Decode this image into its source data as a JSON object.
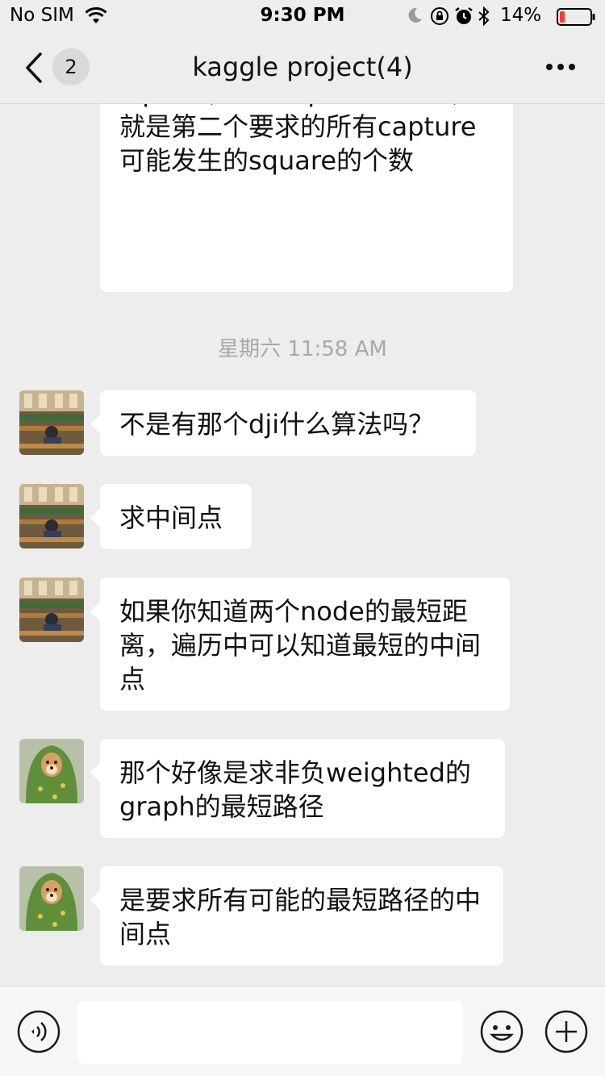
{
  "status_bar": {
    "carrier": "No SIM",
    "time": "9:30 PM",
    "battery": "14%",
    "battery_color": "#ff3b30",
    "icons": [
      "wifi-icon",
      "moon-icon",
      "orientation-lock-icon",
      "alarm-icon",
      "bluetooth-icon",
      "battery-icon"
    ]
  },
  "header": {
    "back_badge": "2",
    "title": "kaggle project(4)",
    "more_icon": "more-dots-icon"
  },
  "chat": {
    "timestamp": "星期六 11:58 AM",
    "messages": [
      {
        "sender": "dog-avatar",
        "text": "离，找到所有最短路径的中间的square，这些square的个数，就是第二个要求的所有capture可能发生的square的个数"
      },
      {
        "sender": "library-avatar",
        "text": "不是有那个dji什么算法吗？"
      },
      {
        "sender": "library-avatar",
        "text": "求中间点"
      },
      {
        "sender": "library-avatar",
        "text": "如果你知道两个node的最短距离，遍历中可以知道最短的中间点"
      },
      {
        "sender": "dog-avatar",
        "text": "那个好像是求非负weighted的graph的最短路径"
      },
      {
        "sender": "dog-avatar",
        "text": "是要求所有可能的最短路径的中间点"
      }
    ]
  },
  "input_bar": {
    "value": "",
    "voice_icon": "voice-icon",
    "emoji_icon": "emoji-icon",
    "plus_icon": "plus-icon"
  },
  "colors": {
    "background": "#ededed",
    "bubble": "#ffffff",
    "timestamp_text": "#a8a8a8"
  }
}
